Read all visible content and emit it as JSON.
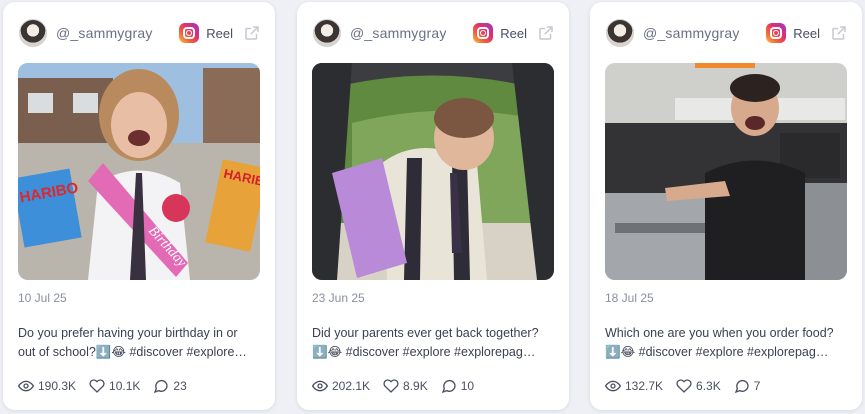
{
  "cards": [
    {
      "handle": "@_sammygray",
      "platform": "Reel",
      "date": "10 Jul 25",
      "caption_line1": "Do you prefer having your birthday in or",
      "caption_line2": "out of school?⬇️😂 #discover #explore…",
      "views": "190.3K",
      "likes": "10.1K",
      "comments": "23",
      "media_sign_1": "HARIBO",
      "media_sign_2": "HARIBO",
      "sash_text": "Birthday"
    },
    {
      "handle": "@_sammygray",
      "platform": "Reel",
      "date": "23 Jun 25",
      "caption_line1": "Did your parents ever get back together?",
      "caption_line2": "⬇️😂 #discover #explore #explorepag…",
      "views": "202.1K",
      "likes": "8.9K",
      "comments": "10"
    },
    {
      "handle": "@_sammygray",
      "platform": "Reel",
      "date": "18 Jul 25",
      "caption_line1": "Which one are you when you order food?",
      "caption_line2": "⬇️😂 #discover #explore #explorepag…",
      "views": "132.7K",
      "likes": "6.3K",
      "comments": "7"
    }
  ],
  "icons": {
    "platform": "instagram-icon",
    "external": "external-link-icon",
    "views": "eye-icon",
    "likes": "heart-icon",
    "comments": "comment-icon"
  }
}
